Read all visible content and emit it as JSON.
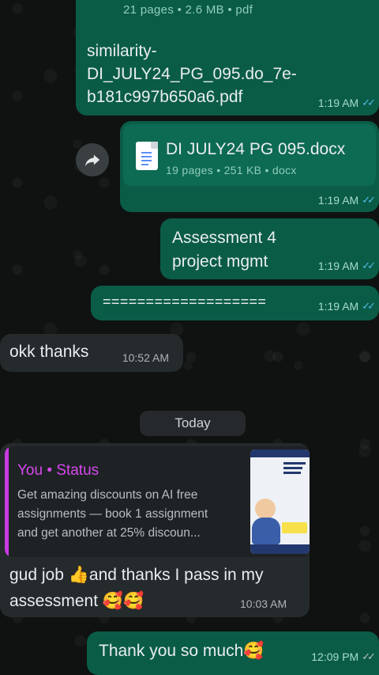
{
  "file1": {
    "meta": "21 pages • 2.6 MB • pdf",
    "filename": "similarity-DI_JULY24_PG_095.do_7e-b181c997b650a6.pdf",
    "filename_line1": "similarity-",
    "filename_line2": "DI_JULY24_PG_095.do_7e-",
    "filename_line3": "b181c997b650a6.pdf",
    "time": "1:19 AM"
  },
  "file2": {
    "filename": "DI JULY24 PG 095.docx",
    "meta": "19 pages • 251 KB • docx",
    "time": "1:19 AM"
  },
  "msg_assessment": {
    "line1": "Assessment 4",
    "line2": "project mgmt",
    "time": "1:19 AM"
  },
  "msg_equals": {
    "text": "===================",
    "time": "1:19 AM"
  },
  "msg_okk": {
    "text": "okk thanks",
    "time": "10:52 AM"
  },
  "date_divider": "Today",
  "reply": {
    "quote_author": "You • Status",
    "quote_line1": "Get amazing discounts on AI free",
    "quote_line2": "assignments — book 1 assignment",
    "quote_line3": "and get another at 25% discoun...",
    "line1_a": "gud job ",
    "line1_emoji": "👍",
    "line1_b": "and thanks I pass in my",
    "line2_text": "assessment ",
    "line2_emoji": "🥰🥰",
    "time": "10:03 AM"
  },
  "msg_thanks": {
    "text": "Thank you so much",
    "emoji": "🥰",
    "time": "12:09 PM"
  },
  "icons": {
    "forward": "forward-arrow-icon",
    "document": "document-icon",
    "read_receipt": "double-check-icon"
  },
  "colors": {
    "outgoing": "#0a5c47",
    "incoming": "#252a2c",
    "status_accent": "#d648ee",
    "read_ticks": "#53bdeb"
  }
}
